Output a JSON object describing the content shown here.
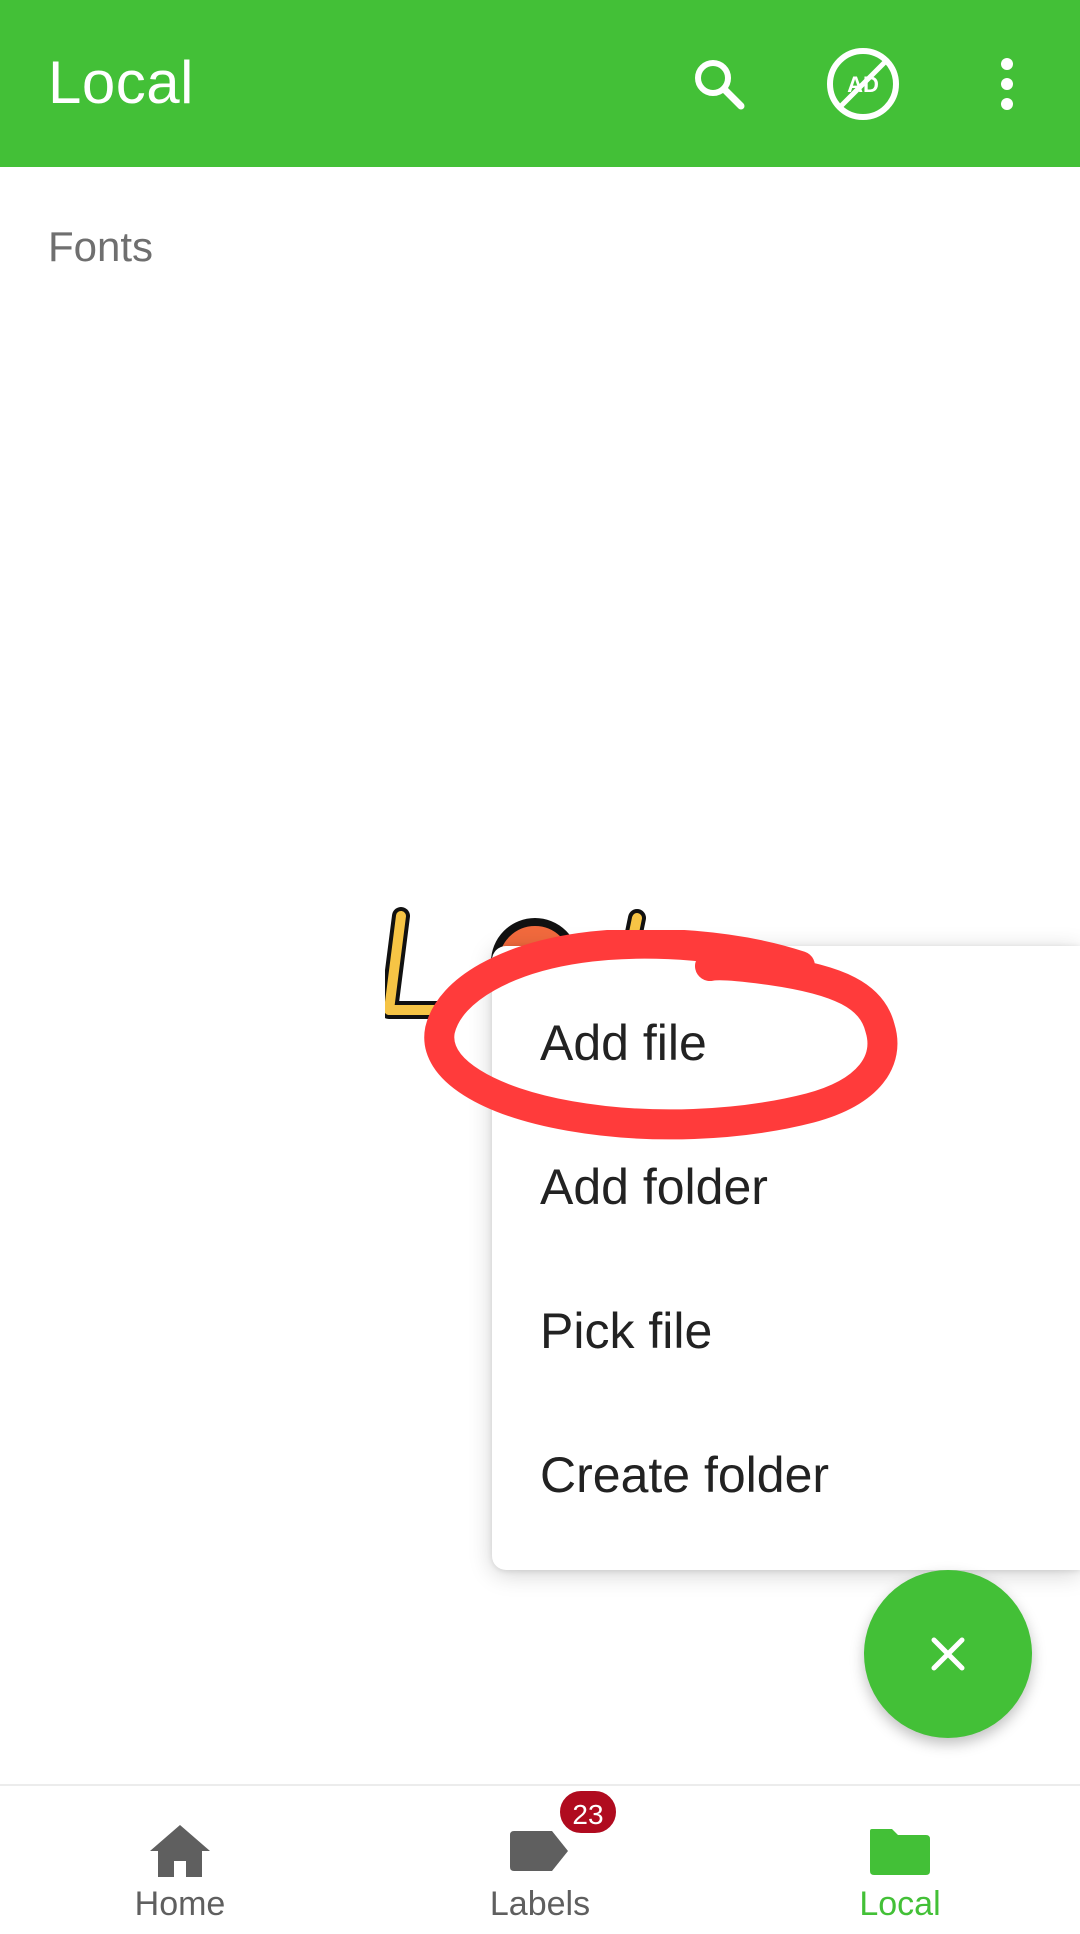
{
  "appbar": {
    "title": "Local",
    "background_color": "#43c037",
    "actions": [
      {
        "icon": "search-icon"
      },
      {
        "icon": "no-ads-icon",
        "text": "AD"
      },
      {
        "icon": "more-vert-icon"
      }
    ]
  },
  "breadcrumb": "Fonts",
  "menu": {
    "items": [
      {
        "label": "Add file"
      },
      {
        "label": "Add folder"
      },
      {
        "label": "Pick file"
      },
      {
        "label": "Create folder"
      }
    ]
  },
  "annotation": {
    "type": "red-circle",
    "color": "#ff3b3b",
    "target": "Add file"
  },
  "fab": {
    "icon": "close-icon",
    "color": "#43c037"
  },
  "bottom_nav": {
    "items": [
      {
        "label": "Home",
        "icon": "home-icon",
        "active": false
      },
      {
        "label": "Labels",
        "icon": "label-icon",
        "active": false,
        "badge": "23"
      },
      {
        "label": "Local",
        "icon": "folder-icon",
        "active": true
      }
    ],
    "active_color": "#43c037",
    "badge_color": "#b00b1f"
  }
}
